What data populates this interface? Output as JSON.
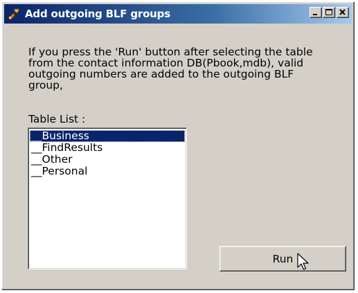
{
  "window": {
    "title": "Add outgoing BLF groups",
    "icon": "wrench-icon",
    "controls": [
      "minimize-icon",
      "maximize-icon",
      "close-icon"
    ]
  },
  "description": "If you press the 'Run' button after selecting the table\nfrom the contact information DB(Pbook,mdb), valid\noutgoing numbers are added to the outgoing BLF\ngroup,",
  "table_list": {
    "label": "Table List :",
    "items": [
      "__Business",
      "__FindResults",
      "__Other",
      "__Personal"
    ],
    "selected": "__Business"
  },
  "run_button": {
    "label": "Run"
  },
  "colors": {
    "title_bar": "#0a246a",
    "selection": "#0a246a",
    "face": "#d4d0c8"
  }
}
